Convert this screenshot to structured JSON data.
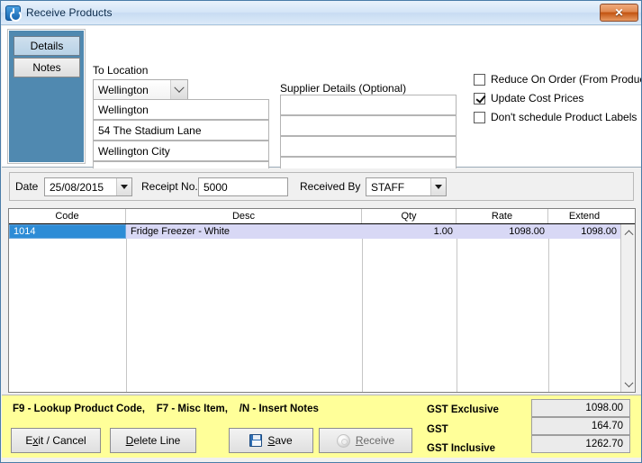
{
  "window": {
    "title": "Receive Products",
    "app_icon": "power-icon",
    "close_label": "✕"
  },
  "sidebar": {
    "tabs": [
      {
        "label": "Details",
        "active": true
      },
      {
        "label": "Notes",
        "active": false
      }
    ]
  },
  "location": {
    "group_label": "To Location",
    "combo_value": "Wellington",
    "combo_icon": "chevron-down-icon",
    "address_lines": [
      "Wellington",
      "54 The Stadium Lane",
      "Wellington City",
      ""
    ]
  },
  "supplier": {
    "group_label": "Supplier Details (Optional)",
    "lines": [
      "",
      "",
      "",
      ""
    ]
  },
  "options": [
    {
      "label": "Reduce On Order (From Products)",
      "checked": false
    },
    {
      "label": "Update Cost Prices",
      "checked": true
    },
    {
      "label": "Don't schedule Product Labels",
      "checked": false
    }
  ],
  "header_fields": {
    "date_label": "Date",
    "date_value": "25/08/2015",
    "receipt_label": "Receipt No.",
    "receipt_value": "5000",
    "received_by_label": "Received By",
    "received_by_value": "STAFF"
  },
  "grid": {
    "columns": [
      "Code",
      "Desc",
      "Qty",
      "Rate",
      "Extend"
    ],
    "rows": [
      {
        "code": "1014",
        "desc": "Fridge Freezer - White",
        "qty": "1.00",
        "rate": "1098.00",
        "extend": "1098.00",
        "selected": true
      }
    ],
    "scroll_up_icon": "chevron-up-icon",
    "scroll_down_icon": "chevron-down-icon"
  },
  "footer": {
    "hint": "F9 - Lookup Product Code,    F7 - Misc Item,    /N - Insert Notes",
    "buttons": [
      {
        "name": "exit-cancel",
        "pre": "E",
        "accel": "x",
        "post": "it / Cancel",
        "icon": ""
      },
      {
        "name": "delete-line",
        "pre": "",
        "accel": "D",
        "post": "elete Line",
        "icon": ""
      },
      {
        "name": "save",
        "pre": "",
        "accel": "S",
        "post": "ave",
        "icon": "floppy-disk-icon"
      },
      {
        "name": "receive",
        "pre": "",
        "accel": "R",
        "post": "eceive",
        "icon": "receive-icon"
      }
    ],
    "totals": [
      {
        "label": "GST Exclusive",
        "value": "1098.00"
      },
      {
        "label": "GST",
        "value": "164.70"
      },
      {
        "label": "GST Inclusive",
        "value": "1262.70"
      }
    ]
  },
  "colors": {
    "sidebar_bg": "#5089b0",
    "footer_bg": "#ffff99",
    "selection_blue": "#2d8cd6",
    "row_highlight": "#d8d8f5"
  }
}
